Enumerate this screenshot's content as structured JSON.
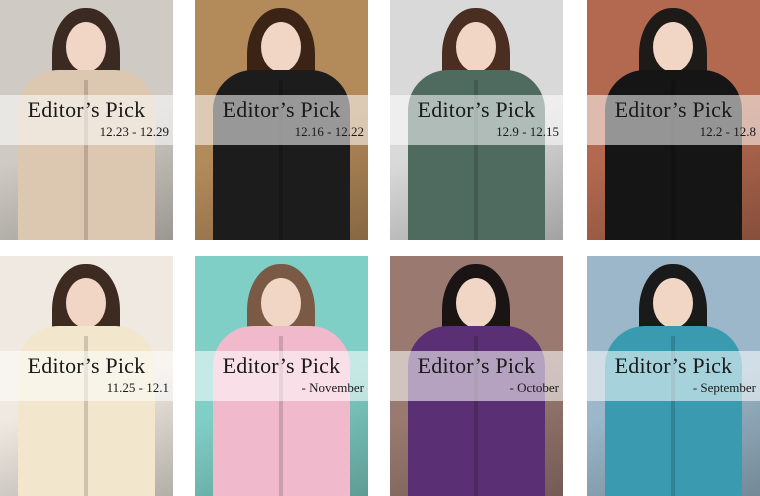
{
  "cards": [
    {
      "title": "Editor’s Pick",
      "date": "12.23 - 12.29",
      "bg": "#cfcac3",
      "coat": "#dcc7b0",
      "hair": "#3a2a22"
    },
    {
      "title": "Editor’s Pick",
      "date": "12.16 - 12.22",
      "bg": "#b38a5a",
      "coat": "#1c1c1c",
      "hair": "#3b2416"
    },
    {
      "title": "Editor’s Pick",
      "date": "12.9 - 12.15",
      "bg": "#d9d9d9",
      "coat": "#4f6b60",
      "hair": "#4a2e22"
    },
    {
      "title": "Editor’s Pick",
      "date": "12.2 - 12.8",
      "bg": "#b3694f",
      "coat": "#151515",
      "hair": "#1e1a18"
    },
    {
      "title": "Editor’s Pick",
      "date": "11.25 - 12.1",
      "bg": "#efe9e1",
      "coat": "#f2e6cc",
      "hair": "#3d2a20"
    },
    {
      "title": "Editor’s Pick",
      "date": "- November",
      "bg": "#7fcfc6",
      "coat": "#f0b9cc",
      "hair": "#7a5a45"
    },
    {
      "title": "Editor’s Pick",
      "date": "- October",
      "bg": "#9a7a70",
      "coat": "#5b2f73",
      "hair": "#1b1414"
    },
    {
      "title": "Editor’s Pick",
      "date": "- September",
      "bg": "#9bb7c9",
      "coat": "#3a9bb0",
      "hair": "#1b1a1a"
    }
  ],
  "icons": {
    "figure": "woman-figure-photo"
  }
}
